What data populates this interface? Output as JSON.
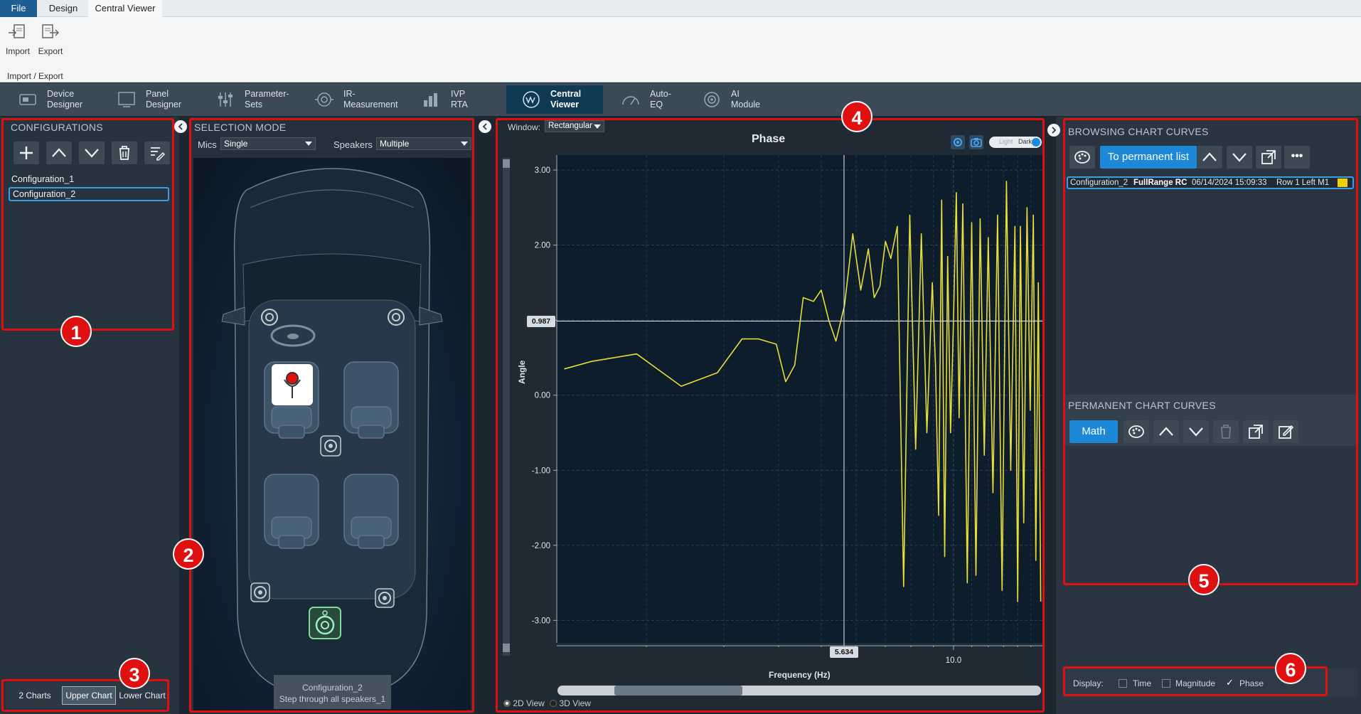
{
  "ribbon": {
    "menu_tabs": [
      "File",
      "Design",
      "Central Viewer"
    ],
    "import_label": "Import",
    "export_label": "Export",
    "group_label": "Import / Export"
  },
  "modules": [
    {
      "line1": "Device",
      "line2": "Designer",
      "icon": "device-designer-icon"
    },
    {
      "line1": "Panel",
      "line2": "Designer",
      "icon": "panel-designer-icon"
    },
    {
      "line1": "Parameter-",
      "line2": "Sets",
      "icon": "parameter-sets-icon"
    },
    {
      "line1": "IR-",
      "line2": "Measurement",
      "icon": "ir-measurement-icon"
    },
    {
      "line1": "IVP",
      "line2": "RTA",
      "icon": "ivp-rta-icon"
    },
    {
      "line1": "Central",
      "line2": "Viewer",
      "icon": "central-viewer-icon",
      "active": true
    },
    {
      "line1": "Auto-",
      "line2": "EQ",
      "icon": "auto-eq-icon"
    },
    {
      "line1": "AI",
      "line2": "Module",
      "icon": "ai-module-icon"
    }
  ],
  "configurations": {
    "title": "CONFIGURATIONS",
    "items": [
      "Configuration_1",
      "Configuration_2"
    ],
    "selected": "Configuration_2"
  },
  "chart_tabs": {
    "items": [
      "2 Charts",
      "Upper Chart",
      "Lower Chart"
    ],
    "active": "Upper Chart"
  },
  "selection_mode": {
    "title": "SELECTION MODE",
    "mics_label": "Mics",
    "mics_value": "Single",
    "speakers_label": "Speakers",
    "speakers_value": "Multiple",
    "footer_line1": "Configuration_2",
    "footer_line2": "Step through all speakers_1"
  },
  "chart_panel": {
    "window_label": "Window:",
    "window_value": "Rectangular",
    "theme_light": "Light",
    "theme_dark": "Dark",
    "view_2d": "2D View",
    "view_3d": "3D View",
    "cursor_y_readout": "0.987",
    "cursor_x_readout": "5.634"
  },
  "chart_data": {
    "type": "line",
    "title": "Phase",
    "xlabel": "Frequency (Hz)",
    "ylabel": "Angle",
    "x_scale": "log",
    "ylim": [
      -3.3,
      3.2
    ],
    "y_ticks": [
      "3.00",
      "2.00",
      "1.00",
      "0.00",
      "-1.00",
      "-2.00",
      "-3.00"
    ],
    "x_tick_labels": [
      "10.0"
    ],
    "grid": true,
    "cursor": {
      "x": 5.634,
      "y": 0.987
    },
    "series": [
      {
        "color": "#e6dc3c",
        "x": [
          1.3,
          1.5,
          1.9,
          2.4,
          2.9,
          3.3,
          3.6,
          3.95,
          4.15,
          4.35,
          4.55,
          4.8,
          5.0,
          5.2,
          5.4,
          5.65,
          5.9,
          6.15,
          6.4,
          6.6,
          6.8,
          7.0,
          7.2,
          7.45,
          7.7,
          7.95,
          8.2,
          8.45,
          8.7,
          8.95,
          9.1,
          9.25,
          9.4,
          9.55,
          9.7,
          9.85,
          10.0,
          10.15,
          10.3,
          10.5,
          10.75,
          11.0,
          11.25,
          11.5,
          11.75,
          12.0,
          12.3,
          12.6,
          12.9,
          13.2,
          13.5,
          13.8,
          14.0,
          14.2,
          14.45,
          14.7,
          14.95,
          15.2,
          15.4,
          15.6,
          15.8
        ],
        "y": [
          0.35,
          0.45,
          0.55,
          0.12,
          0.3,
          0.75,
          0.75,
          0.68,
          0.18,
          0.4,
          1.3,
          1.25,
          1.4,
          1.0,
          0.72,
          1.2,
          2.15,
          1.4,
          1.95,
          1.3,
          1.45,
          2.05,
          1.82,
          2.25,
          -2.55,
          2.4,
          -0.72,
          2.15,
          -0.5,
          1.5,
          0.4,
          -1.6,
          2.6,
          -2.15,
          1.85,
          -0.5,
          1.0,
          2.7,
          -0.3,
          2.55,
          -2.5,
          2.3,
          -2.4,
          2.35,
          -0.8,
          2.1,
          -1.3,
          2.4,
          -2.6,
          2.85,
          -1.0,
          2.25,
          -2.75,
          2.25,
          -1.7,
          2.5,
          -0.2,
          2.4,
          -2.2,
          1.5,
          -2.75
        ]
      }
    ]
  },
  "browsing": {
    "title": "BROWSING CHART CURVES",
    "to_permanent_label": "To permanent list",
    "more_label": "•••",
    "curve": {
      "config": "Configuration_2",
      "name": "FullRange RC",
      "date": "06/14/2024 15:09:33",
      "position": "Row 1 Left M1",
      "color": "#f0d000"
    }
  },
  "permanent": {
    "title": "PERMANENT CHART CURVES",
    "math_label": "Math"
  },
  "display": {
    "label": "Display:",
    "options": [
      {
        "label": "Time",
        "checked": false
      },
      {
        "label": "Magnitude",
        "checked": false
      },
      {
        "label": "Phase",
        "checked": true
      }
    ]
  },
  "annotations": [
    "1",
    "2",
    "3",
    "4",
    "5",
    "6"
  ],
  "colors": {
    "accent_blue": "#1e88d8",
    "highlight_red": "#e01010",
    "curve_yellow": "#e6dc3c",
    "active_module": "#0f3a52"
  }
}
